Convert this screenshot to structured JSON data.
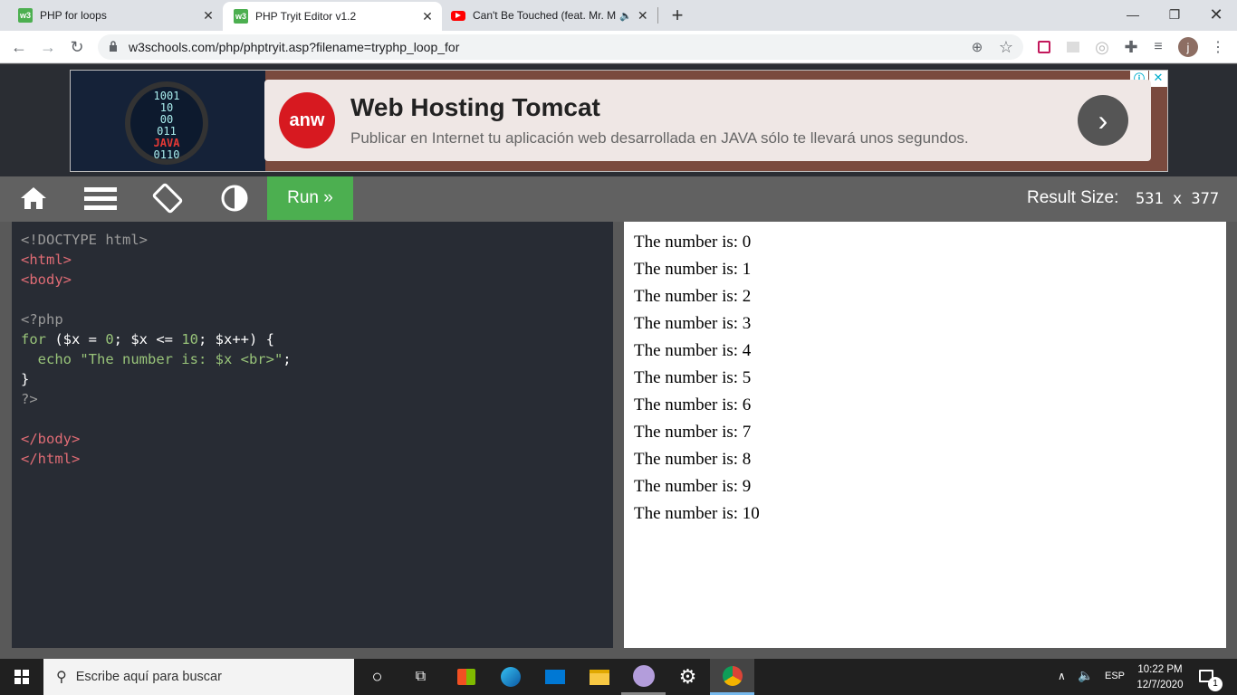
{
  "browser": {
    "tabs": [
      {
        "label": "PHP for loops",
        "favicon_text": "w3",
        "favicon_color": "#4caf50"
      },
      {
        "label": "PHP Tryit Editor v1.2",
        "favicon_text": "w3",
        "favicon_color": "#4caf50"
      },
      {
        "label": "Can't Be Touched (feat. Mr. M",
        "favicon_color": "#ff0000"
      }
    ],
    "url": "w3schools.com/php/phptryit.asp?filename=tryphp_loop_for",
    "profile_initial": "j"
  },
  "ad": {
    "image_text": [
      "1001",
      "10",
      "00",
      "011",
      "JAVA",
      "0110"
    ],
    "logo": "anw",
    "title": "Web Hosting Tomcat",
    "subtitle": "Publicar en Internet tu aplicación web desarrollada en JAVA sólo te llevará unos segundos."
  },
  "editor_toolbar": {
    "run_label": "Run »",
    "result_size_label": "Result Size:",
    "result_size_value": "531 x 377"
  },
  "code": {
    "l1": "<!DOCTYPE html>",
    "l2_open": "<",
    "l2_tag": "html",
    "l2_close": ">",
    "l3_open": "<",
    "l3_tag": "body",
    "l3_close": ">",
    "l5": "<?php",
    "l6_kw": "for",
    "l6_a": " ($x = ",
    "l6_n1": "0",
    "l6_b": "; $x <= ",
    "l6_n2": "10",
    "l6_c": "; $x++) {",
    "l7_kw": "  echo ",
    "l7_str": "\"The number is: $x <br>\"",
    "l7_end": ";",
    "l8": "}",
    "l9": "?>",
    "l11_open": "</",
    "l11_tag": "body",
    "l11_close": ">",
    "l12_open": "</",
    "l12_tag": "html",
    "l12_close": ">"
  },
  "result": {
    "lines": [
      "The number is: 0",
      "The number is: 1",
      "The number is: 2",
      "The number is: 3",
      "The number is: 4",
      "The number is: 5",
      "The number is: 6",
      "The number is: 7",
      "The number is: 8",
      "The number is: 9",
      "The number is: 10"
    ]
  },
  "taskbar": {
    "search_placeholder": "Escribe aquí para buscar",
    "language": "ESP",
    "time": "10:22 PM",
    "date": "12/7/2020",
    "notification_count": "1"
  },
  "colors": {
    "accent_green": "#4caf50",
    "code_bg": "#282c34",
    "tag": "#e06c75",
    "keyword": "#98c379",
    "number": "#d19a66",
    "string": "#98c379",
    "comment": "#9a9a9a"
  }
}
